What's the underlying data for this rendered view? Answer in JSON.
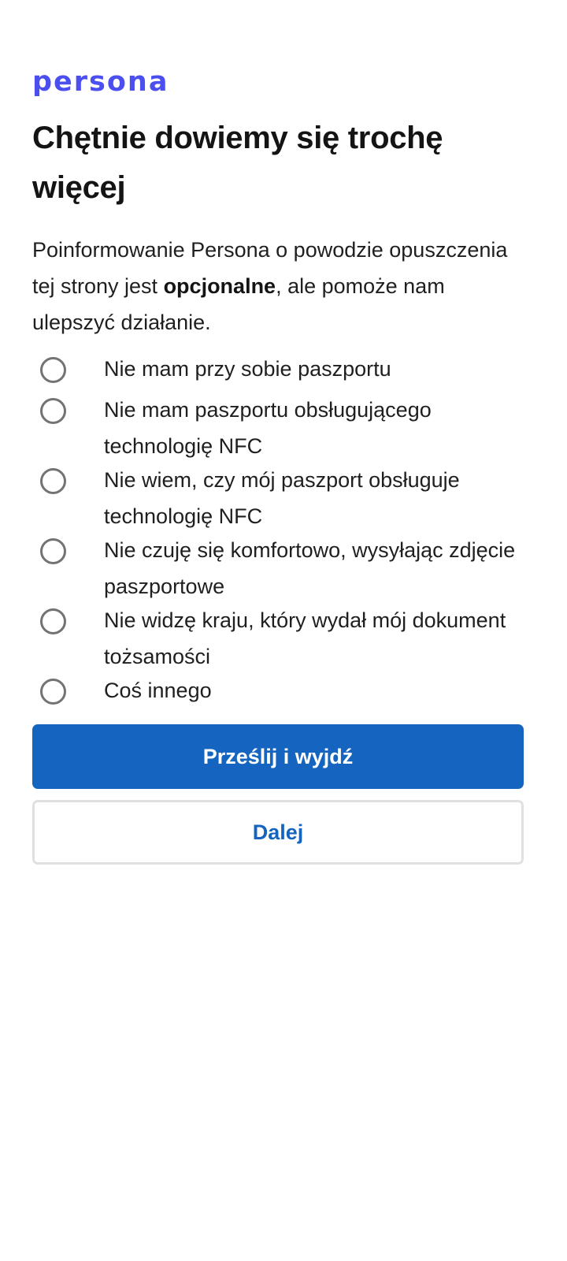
{
  "brand": {
    "logo_text": "persona",
    "color": "#4b4ff0"
  },
  "page": {
    "title": "Chętnie dowiemy się trochę więcej",
    "description_before": "Poinformowanie Persona o powodzie opuszczenia tej strony jest ",
    "description_bold": "opcjonalne",
    "description_after": ", ale pomoże nam ulepszyć działanie."
  },
  "options": [
    {
      "label": "Nie mam przy sobie paszportu",
      "selected": false
    },
    {
      "label": "Nie mam paszportu obsługującego technologię NFC",
      "selected": false
    },
    {
      "label": "Nie wiem, czy mój paszport obsługuje technologię NFC",
      "selected": false
    },
    {
      "label": "Nie czuję się komfortowo, wysyłając zdjęcie paszportowe",
      "selected": false
    },
    {
      "label": "Nie widzę kraju, który wydał mój dokument tożsamości",
      "selected": false
    },
    {
      "label": "Coś innego",
      "selected": false
    }
  ],
  "actions": {
    "submit_label": "Prześlij i wyjdź",
    "next_label": "Dalej",
    "accent_color": "#1565c0"
  }
}
